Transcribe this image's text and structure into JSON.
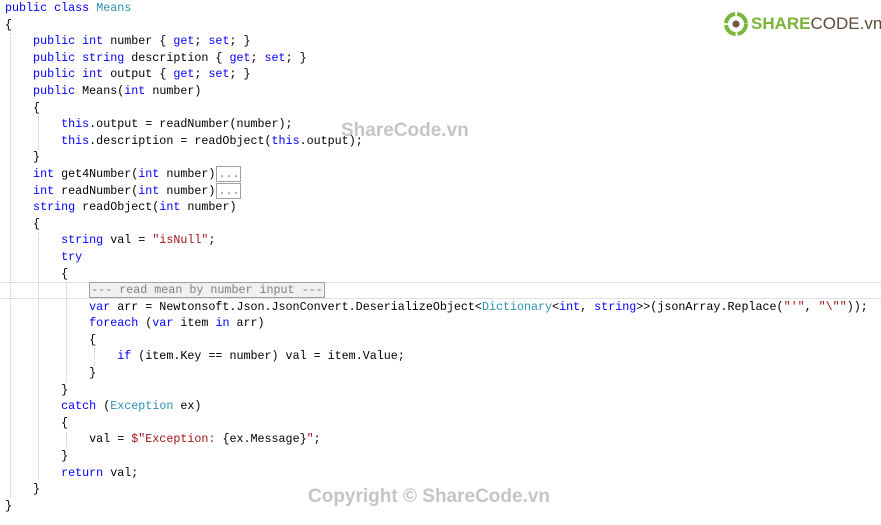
{
  "colors": {
    "keyword": "#0000ff",
    "type": "#2b91af",
    "string": "#a31515",
    "text": "#000000"
  },
  "code": {
    "lines": [
      {
        "tokens": [
          {
            "t": "public class ",
            "c": "kw"
          },
          {
            "t": "Means",
            "c": "ty"
          }
        ]
      },
      {
        "tokens": [
          {
            "t": "{",
            "c": "pl"
          }
        ]
      },
      {
        "tokens": [
          {
            "t": "    public int ",
            "c": "kw"
          },
          {
            "t": "number { ",
            "c": "pl"
          },
          {
            "t": "get",
            "c": "kw"
          },
          {
            "t": "; ",
            "c": "pl"
          },
          {
            "t": "set",
            "c": "kw"
          },
          {
            "t": "; }",
            "c": "pl"
          }
        ]
      },
      {
        "tokens": [
          {
            "t": "    public string ",
            "c": "kw"
          },
          {
            "t": "description { ",
            "c": "pl"
          },
          {
            "t": "get",
            "c": "kw"
          },
          {
            "t": "; ",
            "c": "pl"
          },
          {
            "t": "set",
            "c": "kw"
          },
          {
            "t": "; }",
            "c": "pl"
          }
        ]
      },
      {
        "tokens": [
          {
            "t": "    public int ",
            "c": "kw"
          },
          {
            "t": "output { ",
            "c": "pl"
          },
          {
            "t": "get",
            "c": "kw"
          },
          {
            "t": "; ",
            "c": "pl"
          },
          {
            "t": "set",
            "c": "kw"
          },
          {
            "t": "; }",
            "c": "pl"
          }
        ]
      },
      {
        "tokens": [
          {
            "t": "    public ",
            "c": "kw"
          },
          {
            "t": "Means(",
            "c": "pl"
          },
          {
            "t": "int ",
            "c": "kw"
          },
          {
            "t": "number)",
            "c": "pl"
          }
        ]
      },
      {
        "tokens": [
          {
            "t": "    {",
            "c": "pl"
          }
        ]
      },
      {
        "tokens": [
          {
            "t": "        this",
            "c": "kw"
          },
          {
            "t": ".output = readNumber(number);",
            "c": "pl"
          }
        ]
      },
      {
        "tokens": [
          {
            "t": "        this",
            "c": "kw"
          },
          {
            "t": ".description = readObject(",
            "c": "pl"
          },
          {
            "t": "this",
            "c": "kw"
          },
          {
            "t": ".output);",
            "c": "pl"
          }
        ]
      },
      {
        "tokens": [
          {
            "t": "    }",
            "c": "pl"
          }
        ]
      },
      {
        "tokens": [
          {
            "t": "    int ",
            "c": "kw"
          },
          {
            "t": "get4Number(",
            "c": "pl"
          },
          {
            "t": "int ",
            "c": "kw"
          },
          {
            "t": "number)",
            "c": "pl"
          },
          {
            "t": "...",
            "c": "col"
          }
        ]
      },
      {
        "tokens": [
          {
            "t": "    int ",
            "c": "kw"
          },
          {
            "t": "readNumber(",
            "c": "pl"
          },
          {
            "t": "int ",
            "c": "kw"
          },
          {
            "t": "number)",
            "c": "pl"
          },
          {
            "t": "...",
            "c": "col"
          }
        ]
      },
      {
        "tokens": [
          {
            "t": "    string ",
            "c": "kw"
          },
          {
            "t": "readObject(",
            "c": "pl"
          },
          {
            "t": "int ",
            "c": "kw"
          },
          {
            "t": "number)",
            "c": "pl"
          }
        ]
      },
      {
        "tokens": [
          {
            "t": "    {",
            "c": "pl"
          }
        ]
      },
      {
        "tokens": [
          {
            "t": "        string ",
            "c": "kw"
          },
          {
            "t": "val = ",
            "c": "pl"
          },
          {
            "t": "\"isNull\"",
            "c": "st"
          },
          {
            "t": ";",
            "c": "pl"
          }
        ]
      },
      {
        "tokens": [
          {
            "t": "        try",
            "c": "kw"
          }
        ]
      },
      {
        "tokens": [
          {
            "t": "        {",
            "c": "pl"
          }
        ]
      },
      {
        "tokens": [
          {
            "t": "            ",
            "c": "pl"
          },
          {
            "t": "--- read mean by number input ---",
            "c": "reg"
          }
        ]
      },
      {
        "tokens": [
          {
            "t": "            var ",
            "c": "kw"
          },
          {
            "t": "arr = Newtonsoft.Json.JsonConvert.DeserializeObject<",
            "c": "pl"
          },
          {
            "t": "Dictionary",
            "c": "ty"
          },
          {
            "t": "<",
            "c": "pl"
          },
          {
            "t": "int",
            "c": "kw"
          },
          {
            "t": ", ",
            "c": "pl"
          },
          {
            "t": "string",
            "c": "kw"
          },
          {
            "t": ">>(jsonArray.Replace(",
            "c": "pl"
          },
          {
            "t": "\"'\"",
            "c": "st"
          },
          {
            "t": ", ",
            "c": "pl"
          },
          {
            "t": "\"\\\"\"",
            "c": "st"
          },
          {
            "t": "));",
            "c": "pl"
          }
        ]
      },
      {
        "tokens": [
          {
            "t": "            foreach ",
            "c": "kw"
          },
          {
            "t": "(",
            "c": "pl"
          },
          {
            "t": "var ",
            "c": "kw"
          },
          {
            "t": "item ",
            "c": "pl"
          },
          {
            "t": "in ",
            "c": "kw"
          },
          {
            "t": "arr)",
            "c": "pl"
          }
        ]
      },
      {
        "tokens": [
          {
            "t": "            {",
            "c": "pl"
          }
        ]
      },
      {
        "tokens": [
          {
            "t": "                if ",
            "c": "kw"
          },
          {
            "t": "(item.Key == number) val = item.Value;",
            "c": "pl"
          }
        ]
      },
      {
        "tokens": [
          {
            "t": "            }",
            "c": "pl"
          }
        ]
      },
      {
        "tokens": [
          {
            "t": "        }",
            "c": "pl"
          }
        ]
      },
      {
        "tokens": [
          {
            "t": "        catch ",
            "c": "kw"
          },
          {
            "t": "(",
            "c": "pl"
          },
          {
            "t": "Exception ",
            "c": "ty"
          },
          {
            "t": "ex)",
            "c": "pl"
          }
        ]
      },
      {
        "tokens": [
          {
            "t": "        {",
            "c": "pl"
          }
        ]
      },
      {
        "tokens": [
          {
            "t": "            val = ",
            "c": "pl"
          },
          {
            "t": "$\"Exception: ",
            "c": "st"
          },
          {
            "t": "{ex.Message}",
            "c": "pl"
          },
          {
            "t": "\"",
            "c": "st"
          },
          {
            "t": ";",
            "c": "pl"
          }
        ]
      },
      {
        "tokens": [
          {
            "t": "        }",
            "c": "pl"
          }
        ]
      },
      {
        "tokens": [
          {
            "t": "        return ",
            "c": "kw"
          },
          {
            "t": "val;",
            "c": "pl"
          }
        ]
      },
      {
        "tokens": [
          {
            "t": "    }",
            "c": "pl"
          }
        ]
      },
      {
        "tokens": [
          {
            "t": "}",
            "c": "pl"
          }
        ]
      }
    ]
  },
  "logo": {
    "part1": "SHARE",
    "part2": "CODE.vn"
  },
  "watermarks": {
    "center": "ShareCode.vn",
    "bottom": "Copyright © ShareCode.vn"
  }
}
